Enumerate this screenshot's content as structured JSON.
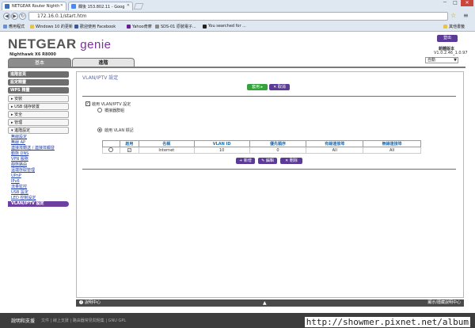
{
  "browser": {
    "tabs": [
      {
        "label": "NETGEAR Router Nighth",
        "active": true
      },
      {
        "label": "欄後 153.802.11 - Goog",
        "active": false
      }
    ],
    "window_controls": [
      "－",
      "□",
      "✕"
    ],
    "url": "172.16.0.1/start.htm",
    "bookmarks": [
      "應用程式",
      "Windows 10 的更新",
      "歡迎使用 Facebook",
      "Yahoo奇摩",
      "SDS-01 原裝電子...",
      "You searched for ...",
      "其他書籤"
    ]
  },
  "header": {
    "logo_main": "NETGEAR",
    "logo_genie": " genie",
    "model": "Nighthawk X6 R8000",
    "logout_label": "登出",
    "firmware_label": "韌體版本",
    "firmware_value": "V1.0.2.46_1.0.97",
    "language": "自動"
  },
  "page_tabs": {
    "basic": "基本",
    "advanced": "進階"
  },
  "sidebar": {
    "heads": [
      "進階首頁",
      "設定精靈",
      "WPS 精靈"
    ],
    "sections": [
      "▸ 安裝",
      "▸ USB 儲存裝置",
      "▸ 安全",
      "▸ 管理",
      "▾ 進階設定"
    ],
    "subitems": [
      "無線設定",
      "無線 AP",
      "連接埠轉送 / 連接埠觸發",
      "動態 DNS",
      "VPN 服務",
      "靜態路由",
      "遠端存取管理",
      "UPnP",
      "IPv6",
      "流量監控",
      "USB 設定",
      "LED 控制設定",
      "VLAN/IPTV 設定"
    ],
    "active_index": 12
  },
  "content": {
    "title": "VLAN/IPTV 設定",
    "apply_label": "套用 ▸",
    "cancel_label": "✕ 取消",
    "enable_label": "啟用 VLAN/IPTV 設定",
    "enable_checked": true,
    "option_bridge": "橋接器群組",
    "option_vlan": "啟用 VLAN 標記",
    "selected_option": "vlan",
    "table": {
      "headers": [
        "",
        "啟用",
        "名稱",
        "VLAN ID",
        "優先順序",
        "有線連接埠",
        "無線連接埠"
      ],
      "rows": [
        {
          "selected": false,
          "enabled": true,
          "name": "Internet",
          "vlan_id": "10",
          "priority": "0",
          "wired": "All",
          "wireless": "All"
        }
      ]
    },
    "add_label": "+ 新增",
    "edit_label": "✎ 編輯",
    "delete_label": "✕ 刪除"
  },
  "help": {
    "left": "說明中心",
    "right": "顯示/隱藏說明中心"
  },
  "footer": {
    "title": "說明和支援",
    "links": "文件 | 線上支援 | 路由器常見問題集 | GNU GPL",
    "watermark": "http://showmer.pixnet.net/album"
  }
}
